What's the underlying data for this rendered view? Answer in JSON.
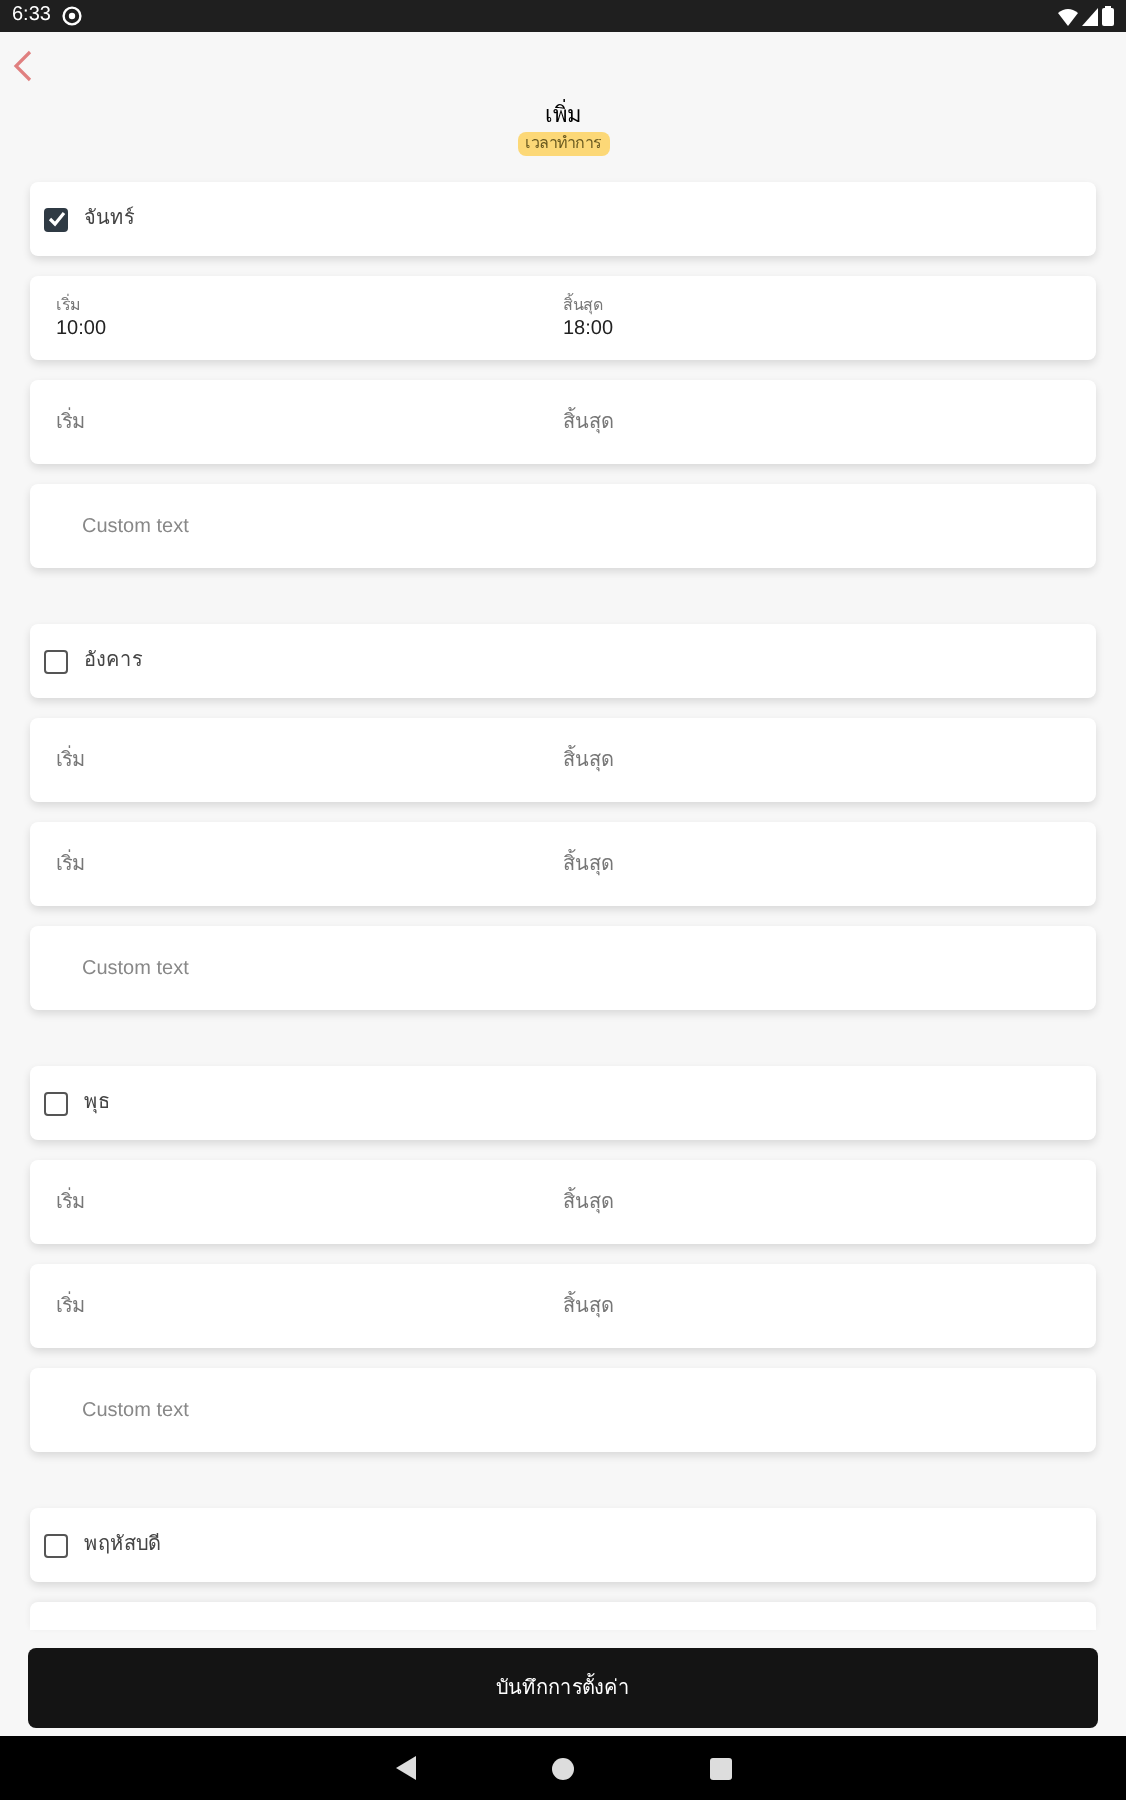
{
  "status_bar": {
    "time": "6:33"
  },
  "header": {
    "title": "เพิ่ม",
    "badge": "เวลาทำการ"
  },
  "days": [
    {
      "name": "จันทร์",
      "checked": true,
      "time_rows": [
        {
          "start_label": "เริ่ม",
          "start_value": "10:00",
          "end_label": "สิ้นสุด",
          "end_value": "18:00"
        },
        {
          "start_label": "เริ่ม",
          "end_label": "สิ้นสุด"
        }
      ],
      "custom_placeholder": "Custom text"
    },
    {
      "name": "อังคาร",
      "checked": false,
      "time_rows": [
        {
          "start_label": "เริ่ม",
          "end_label": "สิ้นสุด"
        },
        {
          "start_label": "เริ่ม",
          "end_label": "สิ้นสุด"
        }
      ],
      "custom_placeholder": "Custom text"
    },
    {
      "name": "พุธ",
      "checked": false,
      "time_rows": [
        {
          "start_label": "เริ่ม",
          "end_label": "สิ้นสุด"
        },
        {
          "start_label": "เริ่ม",
          "end_label": "สิ้นสุด"
        }
      ],
      "custom_placeholder": "Custom text"
    },
    {
      "name": "พฤหัสบดี",
      "checked": false,
      "partial_row": true
    }
  ],
  "save_button": "บันทึกการตั้งค่า"
}
